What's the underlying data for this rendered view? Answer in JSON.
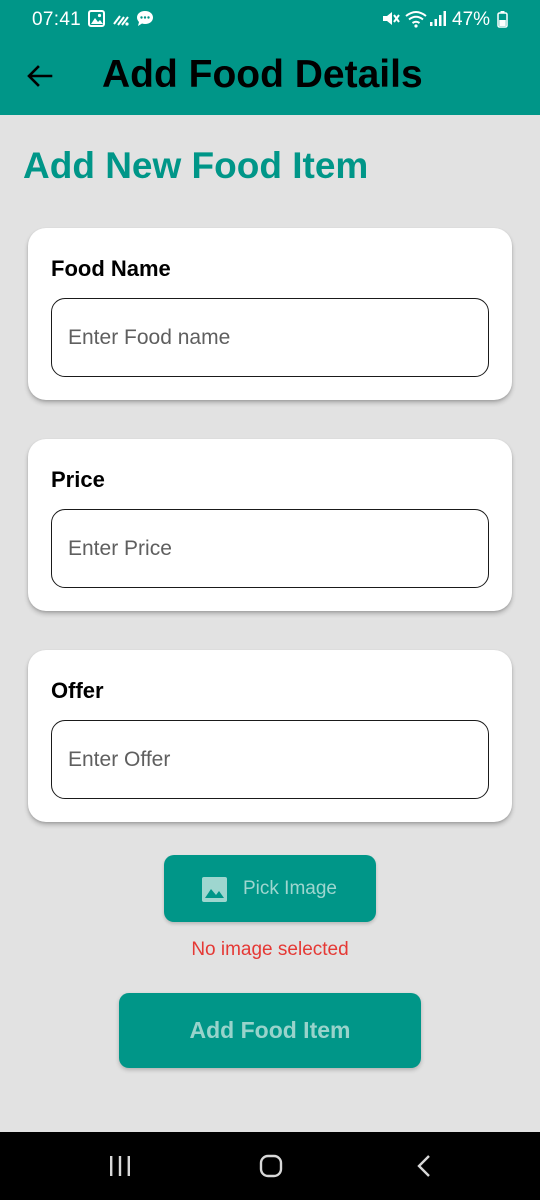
{
  "status_bar": {
    "time": "07:41",
    "battery": "47%",
    "left_icons": [
      "image-icon",
      "wifi-call-icon",
      "chat-bubble-icon"
    ],
    "right_icons": [
      "mute-icon",
      "wifi-icon",
      "signal-icon",
      "battery-icon"
    ]
  },
  "app_bar": {
    "title": "Add Food Details",
    "back_icon": "arrow-back-icon",
    "color": "#009688"
  },
  "page": {
    "heading": "Add New Food Item",
    "heading_color": "#009688"
  },
  "form": {
    "food_name": {
      "label": "Food Name",
      "placeholder": "Enter Food name",
      "value": ""
    },
    "price": {
      "label": "Price",
      "placeholder": "Enter Price",
      "value": ""
    },
    "offer": {
      "label": "Offer",
      "placeholder": "Enter Offer",
      "value": ""
    }
  },
  "pick_image": {
    "label": "Pick Image",
    "icon": "image-icon",
    "status": "No image selected",
    "status_color": "#e53935"
  },
  "submit": {
    "label": "Add Food Item"
  },
  "nav_bar": {
    "items": [
      "recent-apps-icon",
      "home-icon",
      "back-icon"
    ]
  }
}
